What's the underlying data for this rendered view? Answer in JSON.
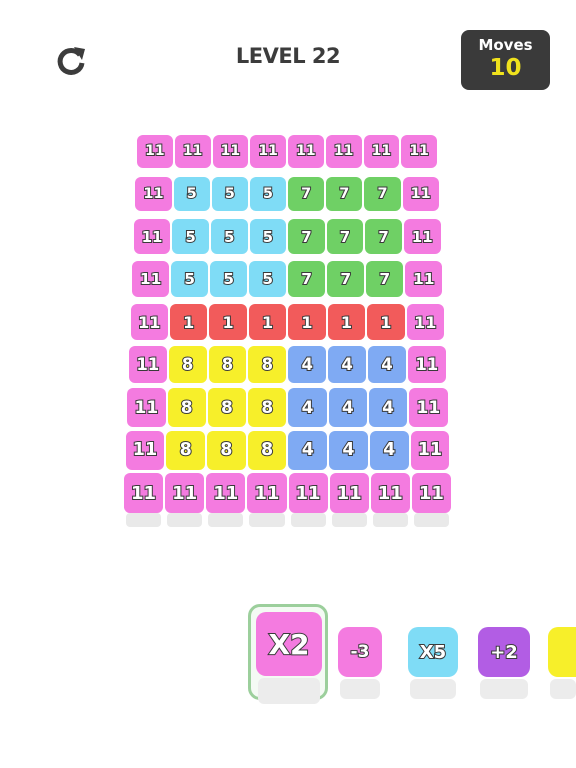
{
  "header": {
    "restart_icon": "restart-icon",
    "level_title": "LEVEL 22",
    "moves_label": "Moves",
    "moves_value": "10"
  },
  "colors": {
    "pink": "#f47be0",
    "cyan": "#7fdcf6",
    "green": "#6fd065",
    "red": "#f25b5b",
    "yellow": "#f7ef2a",
    "blue": "#7faaf3",
    "purple": "#b25de4"
  },
  "board": {
    "rows": [
      [
        {
          "v": "11",
          "c": "pink"
        },
        {
          "v": "11",
          "c": "pink"
        },
        {
          "v": "11",
          "c": "pink"
        },
        {
          "v": "11",
          "c": "pink"
        },
        {
          "v": "11",
          "c": "pink"
        },
        {
          "v": "11",
          "c": "pink"
        },
        {
          "v": "11",
          "c": "pink"
        },
        {
          "v": "11",
          "c": "pink"
        }
      ],
      [
        {
          "v": "11",
          "c": "pink"
        },
        {
          "v": "5",
          "c": "cyan"
        },
        {
          "v": "5",
          "c": "cyan"
        },
        {
          "v": "5",
          "c": "cyan"
        },
        {
          "v": "7",
          "c": "green"
        },
        {
          "v": "7",
          "c": "green"
        },
        {
          "v": "7",
          "c": "green"
        },
        {
          "v": "11",
          "c": "pink"
        }
      ],
      [
        {
          "v": "11",
          "c": "pink"
        },
        {
          "v": "5",
          "c": "cyan"
        },
        {
          "v": "5",
          "c": "cyan"
        },
        {
          "v": "5",
          "c": "cyan"
        },
        {
          "v": "7",
          "c": "green"
        },
        {
          "v": "7",
          "c": "green"
        },
        {
          "v": "7",
          "c": "green"
        },
        {
          "v": "11",
          "c": "pink"
        }
      ],
      [
        {
          "v": "11",
          "c": "pink"
        },
        {
          "v": "5",
          "c": "cyan"
        },
        {
          "v": "5",
          "c": "cyan"
        },
        {
          "v": "5",
          "c": "cyan"
        },
        {
          "v": "7",
          "c": "green"
        },
        {
          "v": "7",
          "c": "green"
        },
        {
          "v": "7",
          "c": "green"
        },
        {
          "v": "11",
          "c": "pink"
        }
      ],
      [
        {
          "v": "11",
          "c": "pink"
        },
        {
          "v": "1",
          "c": "red"
        },
        {
          "v": "1",
          "c": "red"
        },
        {
          "v": "1",
          "c": "red"
        },
        {
          "v": "1",
          "c": "red"
        },
        {
          "v": "1",
          "c": "red"
        },
        {
          "v": "1",
          "c": "red"
        },
        {
          "v": "11",
          "c": "pink"
        }
      ],
      [
        {
          "v": "11",
          "c": "pink"
        },
        {
          "v": "8",
          "c": "yellow"
        },
        {
          "v": "8",
          "c": "yellow"
        },
        {
          "v": "8",
          "c": "yellow"
        },
        {
          "v": "4",
          "c": "blue"
        },
        {
          "v": "4",
          "c": "blue"
        },
        {
          "v": "4",
          "c": "blue"
        },
        {
          "v": "11",
          "c": "pink"
        }
      ],
      [
        {
          "v": "11",
          "c": "pink"
        },
        {
          "v": "8",
          "c": "yellow"
        },
        {
          "v": "8",
          "c": "yellow"
        },
        {
          "v": "8",
          "c": "yellow"
        },
        {
          "v": "4",
          "c": "blue"
        },
        {
          "v": "4",
          "c": "blue"
        },
        {
          "v": "4",
          "c": "blue"
        },
        {
          "v": "11",
          "c": "pink"
        }
      ],
      [
        {
          "v": "11",
          "c": "pink"
        },
        {
          "v": "8",
          "c": "yellow"
        },
        {
          "v": "8",
          "c": "yellow"
        },
        {
          "v": "8",
          "c": "yellow"
        },
        {
          "v": "4",
          "c": "blue"
        },
        {
          "v": "4",
          "c": "blue"
        },
        {
          "v": "4",
          "c": "blue"
        },
        {
          "v": "11",
          "c": "pink"
        }
      ],
      [
        {
          "v": "11",
          "c": "pink"
        },
        {
          "v": "11",
          "c": "pink"
        },
        {
          "v": "11",
          "c": "pink"
        },
        {
          "v": "11",
          "c": "pink"
        },
        {
          "v": "11",
          "c": "pink"
        },
        {
          "v": "11",
          "c": "pink"
        },
        {
          "v": "11",
          "c": "pink"
        },
        {
          "v": "11",
          "c": "pink"
        }
      ]
    ]
  },
  "tray": {
    "items": [
      {
        "label": "X2",
        "c": "pink",
        "selected": true
      },
      {
        "label": "-3",
        "c": "pink",
        "selected": false
      },
      {
        "label": "X5",
        "c": "cyan",
        "selected": false
      },
      {
        "label": "+2",
        "c": "purple",
        "selected": false
      },
      {
        "label": "",
        "c": "yellow",
        "selected": false
      }
    ]
  }
}
